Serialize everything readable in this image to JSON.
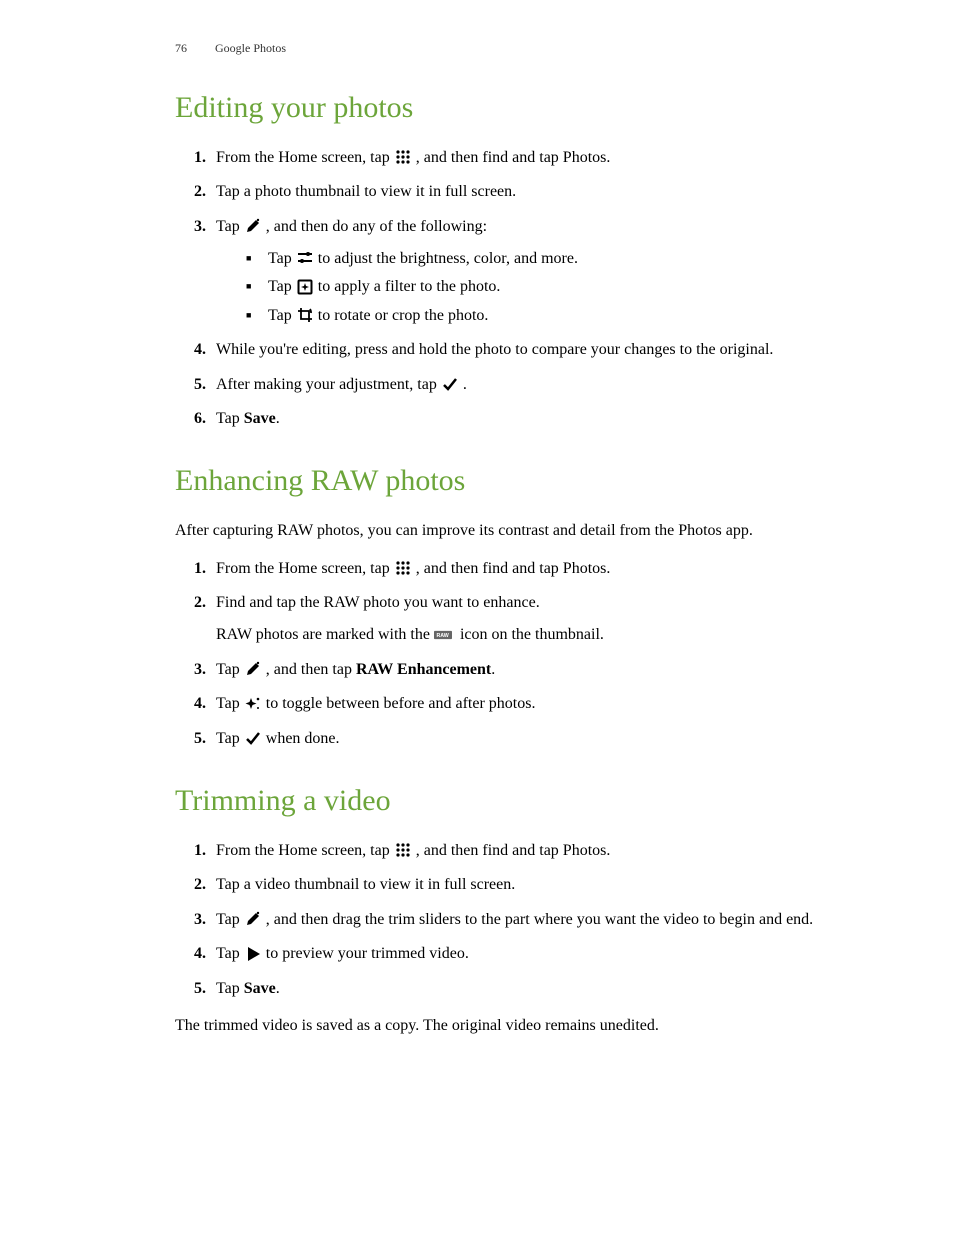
{
  "header": {
    "page": "76",
    "section": "Google Photos"
  },
  "s1": {
    "title": "Editing your photos",
    "steps": {
      "i1a": "From the Home screen, tap ",
      "i1b": ", and then find and tap Photos.",
      "i2": "Tap a photo thumbnail to view it in full screen.",
      "i3a": "Tap ",
      "i3b": ", and then do any of the following:",
      "sub": {
        "a1": "Tap ",
        "a2": " to adjust the brightness, color, and more.",
        "b1": "Tap ",
        "b2": " to apply a filter to the photo.",
        "c1": "Tap ",
        "c2": " to rotate or crop the photo."
      },
      "i4": "While you're editing, press and hold the photo to compare your changes to the original.",
      "i5a": "After making your adjustment, tap ",
      "i5b": ".",
      "i6a": "Tap ",
      "i6b": "Save",
      "i6c": "."
    }
  },
  "s2": {
    "title": "Enhancing RAW photos",
    "intro": "After capturing RAW photos, you can improve its contrast and detail from the Photos app.",
    "steps": {
      "i1a": "From the Home screen, tap ",
      "i1b": ", and then find and tap Photos.",
      "i2a": "Find and tap the RAW photo you want to enhance.",
      "i2b1": "RAW photos are marked with the ",
      "i2b2": " icon on the thumbnail.",
      "i3a": "Tap ",
      "i3b": ", and then tap ",
      "i3c": "RAW Enhancement",
      "i3d": ".",
      "i4a": "Tap ",
      "i4b": " to toggle between before and after photos.",
      "i5a": "Tap ",
      "i5b": " when done."
    }
  },
  "s3": {
    "title": "Trimming a video",
    "steps": {
      "i1a": "From the Home screen, tap ",
      "i1b": ", and then find and tap Photos.",
      "i2": "Tap a video thumbnail to view it in full screen.",
      "i3a": "Tap ",
      "i3b": ", and then drag the trim sliders to the part where you want the video to begin and end.",
      "i4a": "Tap ",
      "i4b": " to preview your trimmed video.",
      "i5a": "Tap ",
      "i5b": "Save",
      "i5c": "."
    },
    "footer": "The trimmed video is saved as a copy. The original video remains unedited."
  }
}
